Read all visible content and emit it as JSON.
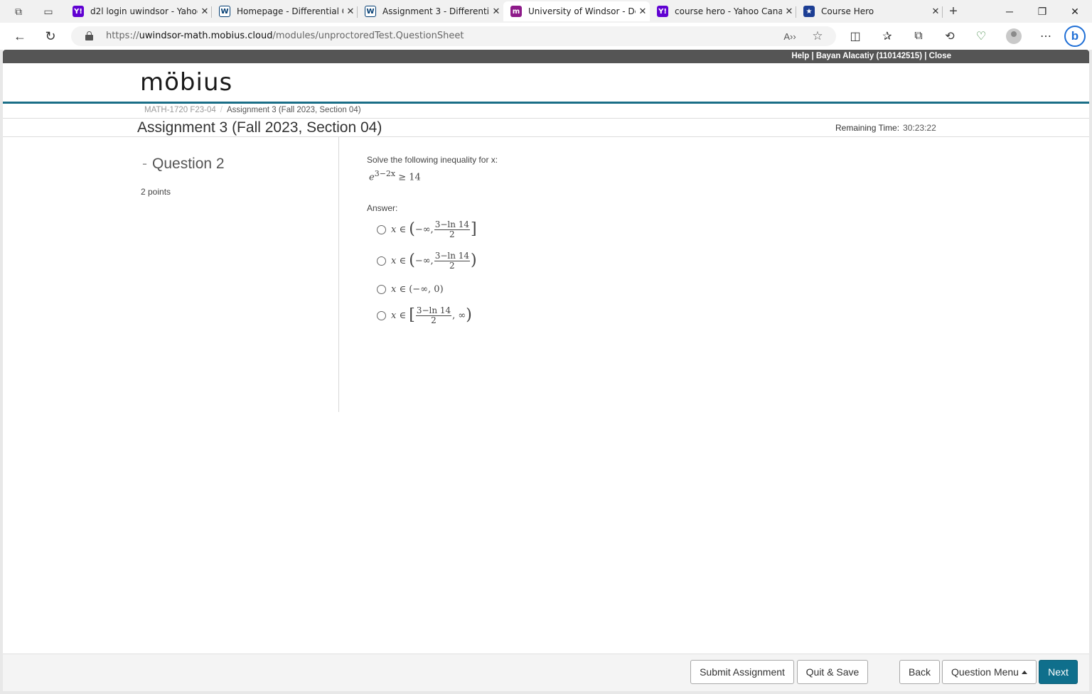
{
  "browser": {
    "tabs": [
      {
        "title": "d2l login uwindsor - Yahoo",
        "favicon": "Y!",
        "favicon_color": "#6001d2"
      },
      {
        "title": "Homepage - Differential Ca",
        "favicon": "W",
        "favicon_color": "#003b71"
      },
      {
        "title": "Assignment 3 - Differentia",
        "favicon": "W",
        "favicon_color": "#003b71"
      },
      {
        "title": "University of Windsor - De",
        "favicon": "m",
        "favicon_color": "#8e1b8a"
      },
      {
        "title": "course hero - Yahoo Canad",
        "favicon": "Y!",
        "favicon_color": "#6001d2"
      },
      {
        "title": "Course Hero",
        "favicon": "★",
        "favicon_color": "#1c3e94"
      }
    ],
    "url_prefix": "https://",
    "url_host": "uwindsor-math.mobius.cloud",
    "url_path": "/modules/unproctoredTest.QuestionSheet"
  },
  "header": {
    "help": "Help",
    "user": "Bayan Alacatiy (110142515)",
    "close": "Close",
    "logo": "möbius"
  },
  "breadcrumb": {
    "course": "MATH-1720 F23-04",
    "current": "Assignment 3 (Fall 2023, Section 04)"
  },
  "assignment": {
    "title": "Assignment 3 (Fall 2023, Section 04)",
    "remaining_label": "Remaining Time:",
    "remaining_value": "30:23:22"
  },
  "question": {
    "label": "Question 2",
    "points": "2 points",
    "prompt": "Solve the following inequality for x:",
    "inequality_base": "e",
    "inequality_exp": "3−2x",
    "inequality_rhs": "≥ 14",
    "answer_label": "Answer:",
    "options": [
      {
        "prefix": "x ∈ ",
        "left": "(",
        "start": "−∞,",
        "num": "3−ln 14",
        "den": "2",
        "end": "",
        "right": "]"
      },
      {
        "prefix": "x ∈ ",
        "left": "(",
        "start": "−∞,",
        "num": "3−ln 14",
        "den": "2",
        "end": "",
        "right": ")"
      },
      {
        "prefix": "x ∈ ",
        "text": "(−∞, 0)"
      },
      {
        "prefix": "x ∈ ",
        "left": "[",
        "start": "",
        "num": "3−ln 14",
        "den": "2",
        "end": ", ∞",
        "right": ")"
      }
    ]
  },
  "footer": {
    "submit": "Submit Assignment",
    "quit": "Quit & Save",
    "back": "Back",
    "menu": "Question Menu",
    "next": "Next"
  }
}
